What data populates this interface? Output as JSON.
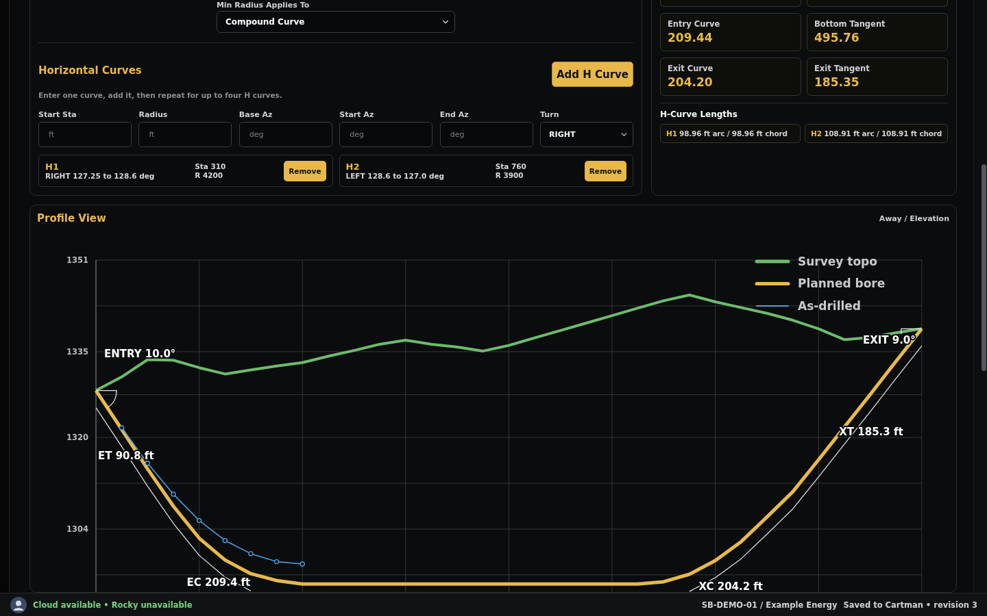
{
  "settings_panel": {
    "min_radius_field": {
      "label": "Min Radius Applies To",
      "value": "Compound Curve"
    }
  },
  "horizontal_curves": {
    "title": "Horizontal Curves",
    "add_button": "Add H Curve",
    "hint": "Enter one curve, add it, then repeat for up to four H curves.",
    "inputs": [
      {
        "label": "Start Sta",
        "kind": "text",
        "placeholder": "ft"
      },
      {
        "label": "Radius",
        "kind": "text",
        "placeholder": "ft"
      },
      {
        "label": "Base Az",
        "kind": "text",
        "placeholder": "deg"
      },
      {
        "label": "Start Az",
        "kind": "text",
        "placeholder": "deg"
      },
      {
        "label": "End Az",
        "kind": "text",
        "placeholder": "deg"
      },
      {
        "label": "Turn",
        "kind": "select",
        "value": "RIGHT"
      }
    ],
    "curves": [
      {
        "name": "H1",
        "detail": "RIGHT 127.25 to 128.6 deg",
        "station": "Sta 310",
        "radius": "R 4200",
        "remove": "Remove"
      },
      {
        "name": "H2",
        "detail": "LEFT 128.6 to 127.0 deg",
        "station": "Sta 760",
        "radius": "R 3900",
        "remove": "Remove"
      }
    ]
  },
  "summary": {
    "cards": [
      {
        "label": "Entry Curve",
        "value": "209.44"
      },
      {
        "label": "Bottom Tangent",
        "value": "495.76"
      },
      {
        "label": "Exit Curve",
        "value": "204.20"
      },
      {
        "label": "Exit Tangent",
        "value": "185.35"
      }
    ],
    "lengths_title": "H-Curve Lengths",
    "lengths": [
      {
        "name": "H1",
        "text": "98.96 ft arc / 98.96 ft chord"
      },
      {
        "name": "H2",
        "text": "108.91 ft arc / 108.91 ft chord"
      }
    ]
  },
  "profile": {
    "title": "Profile View",
    "axis_note": "Away / Elevation",
    "chart_data": {
      "type": "line",
      "ylim": [
        1293,
        1351
      ],
      "yticks": [
        1304,
        1320,
        1335,
        1351
      ],
      "grid": true,
      "legend": "upper right",
      "categories": [
        null,
        null,
        null,
        null,
        null,
        null,
        null,
        null,
        null,
        null,
        null,
        null,
        null,
        null,
        null,
        null,
        null,
        null,
        null,
        null,
        null,
        null,
        null,
        null,
        null,
        null,
        null,
        null,
        null,
        null,
        null,
        null,
        null
      ],
      "series": [
        {
          "name": "Survey topo",
          "color": "#6dbb6d",
          "values": [
            1328.2,
            1330.6,
            1333.6,
            1333.5,
            1332.2,
            1331.1,
            1331.8,
            1332.5,
            1333.1,
            1334.2,
            1335.2,
            1336.3,
            1337.0,
            1336.3,
            1335.8,
            1335.1,
            1336.1,
            1337.4,
            1338.7,
            1340.0,
            1341.3,
            1342.6,
            1343.9,
            1344.9,
            1343.7,
            1342.7,
            1341.7,
            1340.5,
            1339.0,
            1337.1,
            1337.5,
            1338.3,
            1339.0
          ]
        },
        {
          "name": "Planned bore",
          "color": "#e8b94a",
          "values": [
            1328.2,
            1321.4,
            1314.5,
            1308.0,
            1302.4,
            1298.6,
            1296.2,
            1295.0,
            1294.4,
            1294.4,
            1294.4,
            1294.4,
            1294.4,
            1294.4,
            1294.4,
            1294.4,
            1294.4,
            1294.4,
            1294.4,
            1294.4,
            1294.4,
            1294.4,
            1294.8,
            1296.1,
            1298.5,
            1301.8,
            1306.1,
            1310.5,
            1316.1,
            1321.8,
            1327.5,
            1333.3,
            1339.0
          ]
        },
        {
          "name": "As-drilled",
          "color": "#4a9fe0",
          "marker": "o",
          "values": [
            null,
            1321.7,
            1315.5,
            1310.1,
            1305.5,
            1302.0,
            1299.7,
            1298.3,
            1297.9,
            null,
            null,
            null,
            null,
            null,
            null,
            null,
            null,
            null,
            null,
            null,
            null,
            null,
            null,
            null,
            null,
            null,
            null,
            null,
            null,
            null,
            null,
            null,
            null
          ]
        },
        {
          "color": "#e8e8e8",
          "values": [
            1325.2,
            1318.4,
            1311.5,
            1305.0,
            1299.4,
            1295.6,
            1293.2,
            null,
            null,
            null,
            null,
            null,
            null,
            null,
            null,
            null,
            null,
            null,
            null,
            null,
            null,
            null,
            null,
            1293.1,
            1295.5,
            1298.8,
            1303.1,
            1307.5,
            1313.1,
            1318.8,
            1324.5,
            1330.3,
            1336.0
          ]
        }
      ],
      "annotations": [
        "ENTRY 10.0°",
        "EXIT 9.0°",
        "ET 90.8 ft",
        "EC 209.4 ft",
        "XC 204.2 ft",
        "XT 185.3 ft"
      ]
    }
  },
  "status_bar": {
    "connection": "Cloud available • Rocky unavailable",
    "project": "SB-DEMO-01 / Example Energy",
    "save_state": "Saved to Cartman • revision 3"
  }
}
